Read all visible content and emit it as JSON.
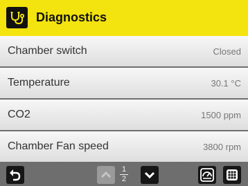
{
  "header": {
    "title": "Diagnostics",
    "icon": "stethoscope-icon",
    "accent": "#f3e30e"
  },
  "rows": [
    {
      "label": "Chamber switch",
      "value": "Closed"
    },
    {
      "label": "Temperature",
      "value": "30.1 °C"
    },
    {
      "label": "CO2",
      "value": "1500 ppm"
    },
    {
      "label": "Chamber Fan speed",
      "value": "3800 rpm"
    }
  ],
  "footer": {
    "page_current": "1",
    "page_total": "2",
    "back_icon": "back-arrow-icon",
    "up_icon": "chevron-up-icon",
    "down_icon": "chevron-down-icon",
    "gauge_icon": "gauge-icon",
    "menu_icon": "grid-menu-icon"
  }
}
